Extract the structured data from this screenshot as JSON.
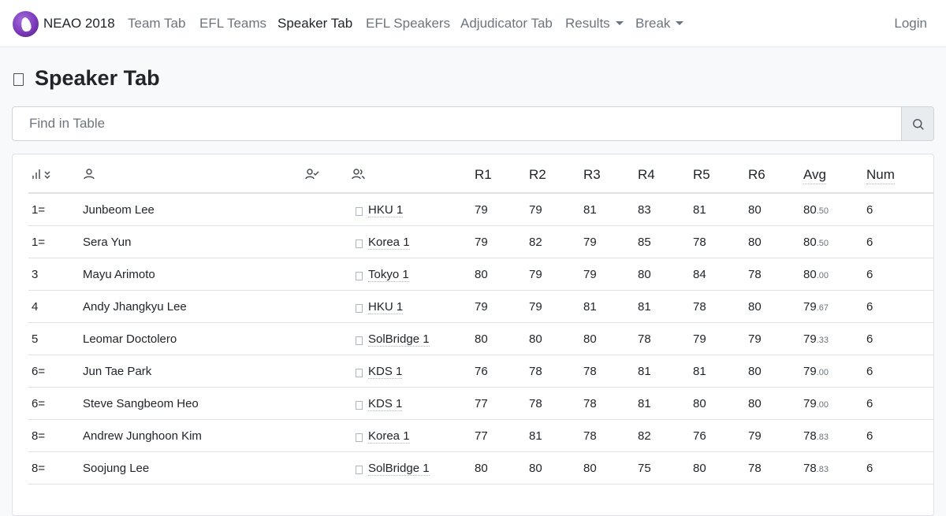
{
  "navbar": {
    "brand": "NEAO 2018",
    "items": [
      {
        "label": "Team Tab",
        "active": false
      },
      {
        "label": "EFL Teams",
        "active": false
      },
      {
        "label": "Speaker Tab",
        "active": true
      },
      {
        "label": "EFL Speakers",
        "active": false
      },
      {
        "label": "Adjudicator Tab",
        "active": false
      },
      {
        "label": "Results",
        "dropdown": true
      },
      {
        "label": "Break",
        "dropdown": true
      }
    ],
    "login": "Login"
  },
  "page": {
    "title": "Speaker Tab",
    "title_icon": "file-icon"
  },
  "search": {
    "placeholder": "Find in Table",
    "icon": "search-icon"
  },
  "table": {
    "header_icons": [
      "rank-sort-icon",
      "speaker-icon",
      "team-icon-header",
      "institution-icon"
    ],
    "columns": [
      "R1",
      "R2",
      "R3",
      "R4",
      "R5",
      "R6",
      "Avg",
      "Num"
    ],
    "rows": [
      {
        "rank": "1=",
        "name": "Junbeom Lee",
        "team": "HKU 1",
        "scores": [
          "79",
          "79",
          "81",
          "83",
          "81",
          "80"
        ],
        "avg_int": "80",
        "avg_dec": ".50",
        "num": "6"
      },
      {
        "rank": "1=",
        "name": "Sera Yun",
        "team": "Korea 1",
        "scores": [
          "79",
          "82",
          "79",
          "85",
          "78",
          "80"
        ],
        "avg_int": "80",
        "avg_dec": ".50",
        "num": "6"
      },
      {
        "rank": "3",
        "name": "Mayu Arimoto",
        "team": "Tokyo 1",
        "scores": [
          "80",
          "79",
          "79",
          "80",
          "84",
          "78"
        ],
        "avg_int": "80",
        "avg_dec": ".00",
        "num": "6"
      },
      {
        "rank": "4",
        "name": "Andy Jhangkyu Lee",
        "team": "HKU 1",
        "scores": [
          "79",
          "79",
          "81",
          "81",
          "78",
          "80"
        ],
        "avg_int": "79",
        "avg_dec": ".67",
        "num": "6"
      },
      {
        "rank": "5",
        "name": "Leomar Doctolero",
        "team": "SolBridge 1",
        "scores": [
          "80",
          "80",
          "80",
          "78",
          "79",
          "79"
        ],
        "avg_int": "79",
        "avg_dec": ".33",
        "num": "6"
      },
      {
        "rank": "6=",
        "name": "Jun Tae Park",
        "team": "KDS 1",
        "scores": [
          "76",
          "78",
          "78",
          "81",
          "81",
          "80"
        ],
        "avg_int": "79",
        "avg_dec": ".00",
        "num": "6"
      },
      {
        "rank": "6=",
        "name": "Steve Sangbeom Heo",
        "team": "KDS 1",
        "scores": [
          "77",
          "78",
          "78",
          "81",
          "80",
          "80"
        ],
        "avg_int": "79",
        "avg_dec": ".00",
        "num": "6"
      },
      {
        "rank": "8=",
        "name": "Andrew Junghoon Kim",
        "team": "Korea 1",
        "scores": [
          "77",
          "81",
          "78",
          "82",
          "76",
          "79"
        ],
        "avg_int": "78",
        "avg_dec": ".83",
        "num": "6"
      },
      {
        "rank": "8=",
        "name": "Soojung Lee",
        "team": "SolBridge 1",
        "scores": [
          "80",
          "80",
          "80",
          "75",
          "80",
          "78"
        ],
        "avg_int": "78",
        "avg_dec": ".83",
        "num": "6"
      }
    ]
  }
}
